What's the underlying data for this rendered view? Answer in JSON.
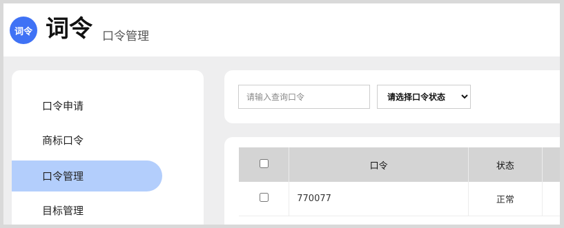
{
  "header": {
    "logo_text": "词令",
    "title": "词令",
    "subtitle": "口令管理"
  },
  "sidebar": {
    "items": [
      {
        "label": "口令申请",
        "active": false
      },
      {
        "label": "商标口令",
        "active": false
      },
      {
        "label": "口令管理",
        "active": true
      },
      {
        "label": "目标管理",
        "active": false
      }
    ]
  },
  "filters": {
    "search_placeholder": "请输入查询口令",
    "search_value": "",
    "status_select": {
      "selected": "请选择口令状态"
    }
  },
  "table": {
    "columns": [
      "",
      "口令",
      "状态"
    ],
    "rows": [
      {
        "checked": false,
        "code": "770077",
        "status": "正常"
      }
    ]
  },
  "colors": {
    "brand": "#3f72f5",
    "active_nav": "#b3cefc",
    "table_header": "#d4d4d4",
    "page_bg": "#eeeeef"
  }
}
